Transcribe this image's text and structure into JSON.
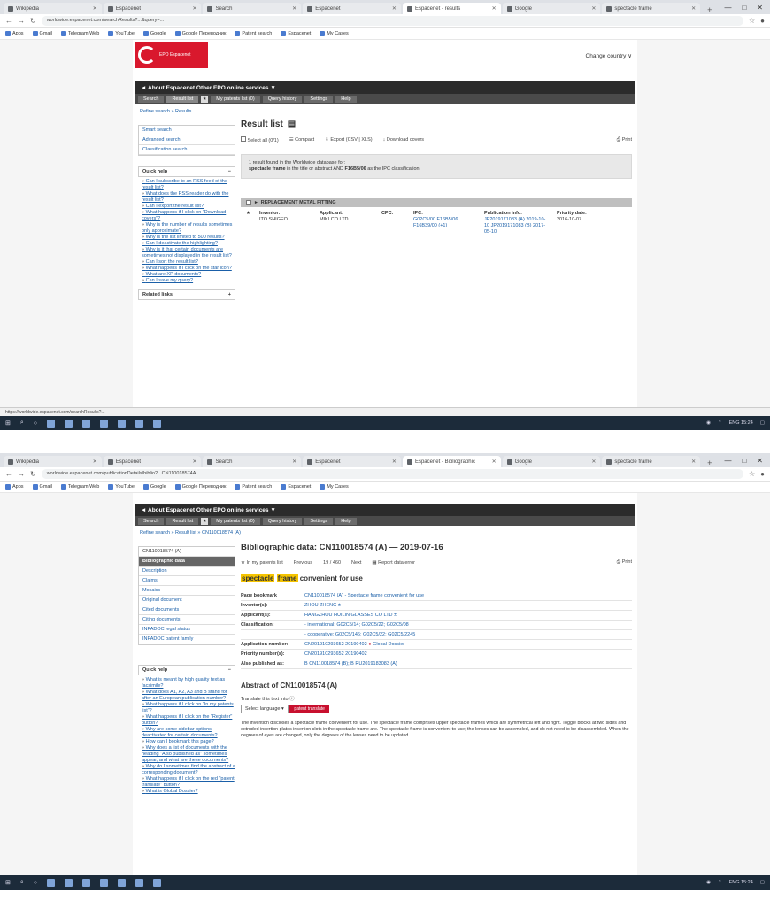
{
  "shot1": {
    "tabs": [
      "Wikipedia",
      "Espacenet",
      "Search",
      "Espacenet",
      "Espacenet - results",
      "Google",
      "spectacle frame"
    ],
    "url": "worldwide.espacenet.com/searchResults?...&query=...",
    "bookmarks": [
      "Apps",
      "Gmail",
      "Telegram Web",
      "YouTube",
      "Google",
      "Google Переводчик",
      "Patent search",
      "Espacenet",
      "My Cases"
    ],
    "logo_text": "EPO Espacenet",
    "change_country": "Change country ∨",
    "topnav": "◄ About Espacenet  Other EPO online services ▼",
    "menu": [
      "Search",
      "Result list",
      "My patents list (0)",
      "Query history",
      "Settings",
      "Help"
    ],
    "crumb": "Refine search » Results",
    "left_links": [
      "Smart search",
      "Advanced search",
      "Classification search"
    ],
    "quick_help_title": "Quick help",
    "quick_help_links": [
      "Can I subscribe to an RSS feed of the result list?",
      "What does the RSS reader do with the result list?",
      "Can I export the result list?",
      "What happens if I click on \"Download covers\"?",
      "Why is the number of results sometimes only approximate?",
      "Why is the list limited to 500 results?",
      "Can I deactivate the highlighting?",
      "Why is it that certain documents are sometimes not displayed in the result list?",
      "Can I sort the result list?",
      "What happens if I click on the star icon?",
      "What are XP documents?",
      "Can I save my query?"
    ],
    "related_links": "Related links",
    "title": "Result list",
    "toolbar": [
      "Select all (0/1)",
      "Compact",
      "Export (CSV | XLS)",
      "Download covers",
      "Print"
    ],
    "info_line1": "1 result found in the Worldwide database for:",
    "info_line2_a": "spectacle frame",
    "info_line2_b": "in the title or abstract AND",
    "info_line2_c": "F16B5/06",
    "info_line2_d": "as the IPC classification",
    "result_title": "REPLACEMENT METAL FITTING",
    "result_cols": [
      {
        "label": "Inventor:",
        "value": "ITO SHIGEO"
      },
      {
        "label": "Applicant:",
        "value": "MIKI CO LTD"
      },
      {
        "label": "CPC:",
        "value": ""
      },
      {
        "label": "IPC:",
        "value": "G02C5/00 F16B5/06 F16B39/00 (+1)"
      },
      {
        "label": "Publication info:",
        "value": "JP2019171083 (A) 2019-10-10 JP2019171083 (B) 2017-05-10"
      },
      {
        "label": "Priority date:",
        "value": "2016-10-07"
      }
    ],
    "status_url": "https://worldwide.espacenet.com/searchResults?...",
    "clock": "ENG 15:24"
  },
  "shot2": {
    "tabs": [
      "Wikipedia",
      "Espacenet",
      "Search",
      "Espacenet",
      "Espacenet - Bibliographic",
      "Google",
      "spectacle frame"
    ],
    "url": "worldwide.espacenet.com/publicationDetails/biblio?...CN110018574A",
    "topnav": "◄ About Espacenet  Other EPO online services ▼",
    "menu": [
      "Search",
      "Result list",
      "My patents list (0)",
      "Query history",
      "Settings",
      "Help"
    ],
    "crumb": "Refine search » Result list » CN110018574 (A)",
    "left_header": "CN110018574 (A)",
    "left_items": [
      "Bibliographic data",
      "Description",
      "Claims",
      "Mosaics",
      "Original document",
      "Cited documents",
      "Citing documents",
      "INPADOC legal status",
      "INPADOC patent family"
    ],
    "quick_help_title": "Quick help",
    "quick_help_links": [
      "What is meant by high quality text as facsimile?",
      "What does A1, A2, A3 and B stand for after an European publication number?",
      "What happens if I click on \"In my patents list\"?",
      "What happens if I click on the \"Register\" button?",
      "Why are some sidebar options deactivated for certain documents?",
      "How can I bookmark this page?",
      "Why does a list of documents with the heading \"Also published as\" sometimes appear, and what are these documents?",
      "Why do I sometimes find the abstract of a corresponding document?",
      "What happens if I click on the red \"patent translate\" button?",
      "What is Global Dossier?"
    ],
    "title": "Bibliographic data: CN110018574 (A) — 2019-07-16",
    "toolbar": [
      "In my patents list",
      "Previous",
      "19 / 460",
      "Next",
      "Report data error",
      "Print"
    ],
    "inv_title_a": "spectacle",
    "inv_title_b": "frame",
    "inv_title_c": "convenient for use",
    "rows": [
      {
        "k": "Page bookmark",
        "v": "CN110018574 (A) - Spectacle frame convenient for use"
      },
      {
        "k": "Inventor(s):",
        "v": "ZHOU ZHENG ±"
      },
      {
        "k": "Applicant(s):",
        "v": "HANGZHOU HUILIN GLASSES CO LTD ±"
      },
      {
        "k": "Classification:",
        "v": "- international: G02C5/14; G02C5/22; G02C5/08"
      },
      {
        "k": "",
        "v": "- cooperative: G02C5/146; G02C5/22; G02C5/2245"
      },
      {
        "k": "Application number:",
        "v": "CN201910293652 20190402"
      },
      {
        "k": "Priority number(s):",
        "v": "CN201910293652 20190402"
      },
      {
        "k": "Also published as:",
        "v": "B CN110018574 (B); B RU2019183083 (A)"
      }
    ],
    "global_dossier": "Global Dossier",
    "abs_title": "Abstract of CN110018574 (A)",
    "translate_label": "Translate this text into",
    "select_lang": "Select language",
    "patent_translate": "patent translate",
    "abstract": "The invention discloses a spectacle frame convenient for use. The spectacle frame comprises upper spectacle frames which are symmetrical left and right. Toggle blocks at two sides and extruded insertion plates insertion slots in the spectacle frame are. The spectacle frame is convenient to use; the lenses can be assembled, and do not need to be disassembled. When the degrees of eyes are changed, only the degrees of the lenses need to be updated.",
    "clock": "ENG 15:24"
  },
  "colors": {
    "accent": "#d9182d",
    "highlight": "#f5c400",
    "link": "#1a5fa8",
    "dark": "#2b2b2b"
  }
}
